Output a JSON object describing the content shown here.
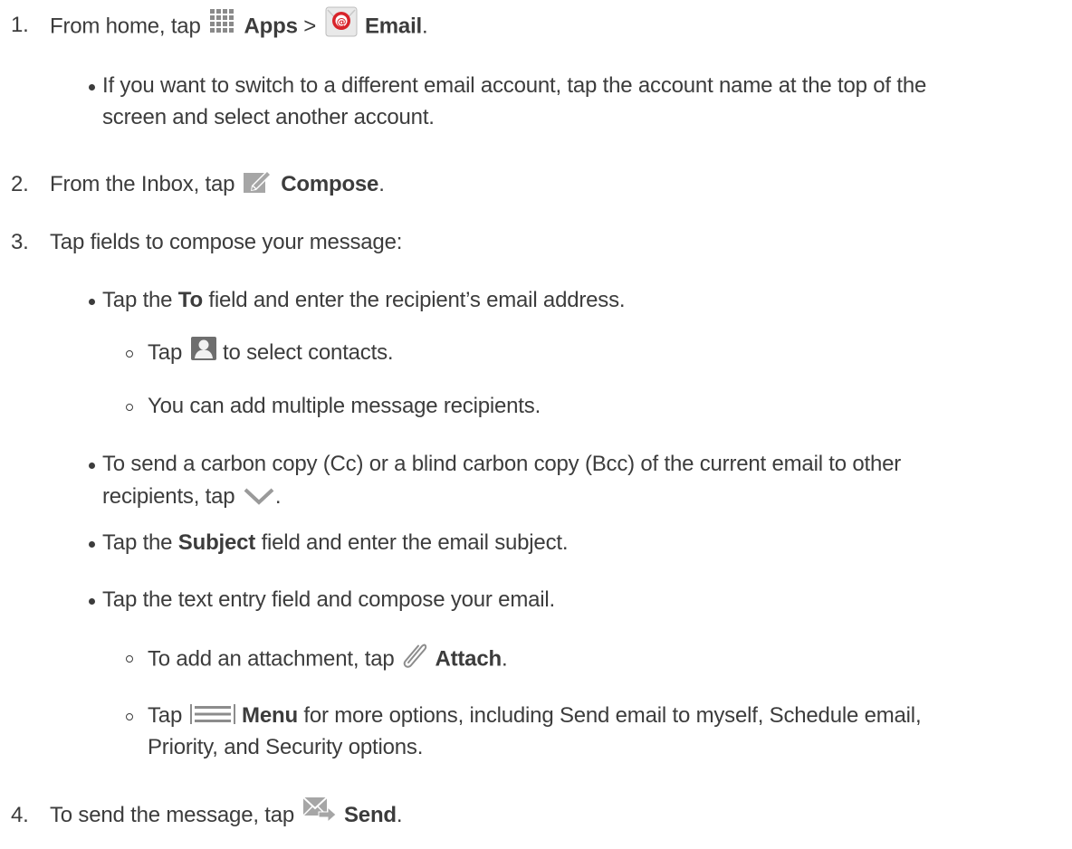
{
  "steps": [
    {
      "number": "1.",
      "prefix": "From home, tap",
      "apps_label": "Apps",
      "separator": ">",
      "email_label": "Email",
      "period": ".",
      "bullets": [
        {
          "line1": "If you want to switch to a different email account, tap the account name at the top of the",
          "line2": "screen and select another account."
        }
      ]
    },
    {
      "number": "2.",
      "prefix": "From the Inbox, tap",
      "compose_label": "Compose",
      "period": "."
    },
    {
      "number": "3.",
      "text": "Tap fields to compose your message:",
      "bullets": [
        {
          "pre": "Tap the",
          "bold": "To",
          "post": "field and enter the recipient’s email address.",
          "subs": [
            {
              "pre": "Tap",
              "post": "to select contacts."
            },
            {
              "text": "You can add multiple message recipients."
            }
          ]
        },
        {
          "line1": "To send a carbon copy (Cc) or a blind carbon copy (Bcc) of the current email to other",
          "line2_pre": "recipients, tap",
          "line2_post": "."
        },
        {
          "pre": "Tap the",
          "bold": "Subject",
          "post": "field and enter the email subject."
        },
        {
          "text": "Tap the text entry field and compose your email.",
          "subs": [
            {
              "pre": "To add an attachment, tap",
              "bold": "Attach",
              "post": "."
            },
            {
              "pre": "Tap",
              "bold": "Menu",
              "post": "for more options, including Send email to myself, Schedule email,",
              "line2": "Priority, and Security options."
            }
          ]
        }
      ]
    },
    {
      "number": "4.",
      "prefix": "To send the message, tap",
      "send_label": "Send",
      "period": "."
    }
  ],
  "icons": {
    "apps": "apps-grid-icon",
    "email": "email-app-icon",
    "compose": "compose-icon",
    "contact": "contact-icon",
    "chevron": "chevron-down-icon",
    "attach": "paperclip-icon",
    "menu": "menu-icon",
    "send": "send-icon"
  }
}
